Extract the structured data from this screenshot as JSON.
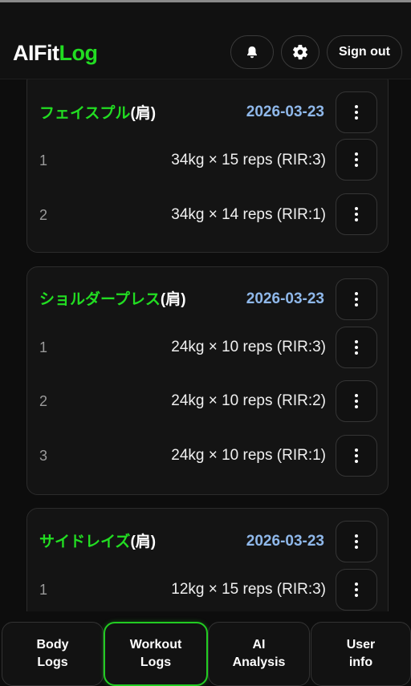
{
  "app": {
    "logo_part1": "AIFit",
    "logo_part2": "Log",
    "signout_label": "Sign out"
  },
  "cards": [
    {
      "exercise": "フェイスプル",
      "body_part": "(肩)",
      "date": "2026-03-23",
      "sets": [
        {
          "num": "1",
          "value": "34kg × 15 reps (RIR:3)"
        },
        {
          "num": "2",
          "value": "34kg × 14 reps (RIR:1)"
        }
      ]
    },
    {
      "exercise": "ショルダープレス",
      "body_part": "(肩)",
      "date": "2026-03-23",
      "sets": [
        {
          "num": "1",
          "value": "24kg × 10 reps (RIR:3)"
        },
        {
          "num": "2",
          "value": "24kg × 10 reps (RIR:2)"
        },
        {
          "num": "3",
          "value": "24kg × 10 reps (RIR:1)"
        }
      ]
    },
    {
      "exercise": "サイドレイズ",
      "body_part": "(肩)",
      "date": "2026-03-23",
      "sets": [
        {
          "num": "1",
          "value": "12kg × 15 reps (RIR:3)"
        }
      ]
    }
  ],
  "nav": {
    "tabs": [
      {
        "line1": "Body",
        "line2": "Logs",
        "active": false
      },
      {
        "line1": "Workout",
        "line2": "Logs",
        "active": true
      },
      {
        "line1": "AI",
        "line2": "Analysis",
        "active": false
      },
      {
        "line1": "User",
        "line2": "info",
        "active": false
      }
    ]
  },
  "colors": {
    "accent": "#22dd22",
    "date": "#8fb8ea",
    "background": "#0d0d0d"
  },
  "icons": {
    "bell": "bell-icon",
    "settings": "gear-icon",
    "menu": "kebab-menu-icon"
  }
}
